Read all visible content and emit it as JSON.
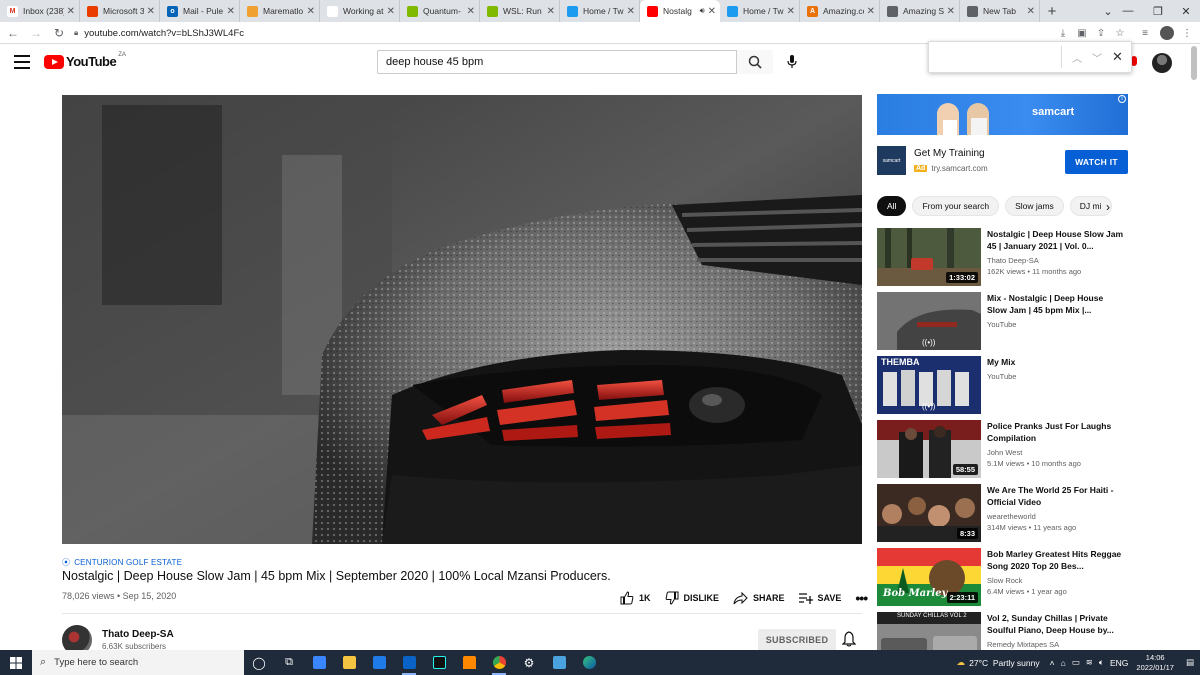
{
  "browser": {
    "tabs": [
      {
        "title": "Inbox (238)",
        "color": "#ffffff",
        "glyph": "M",
        "glyph_color": "#d93025",
        "active": false
      },
      {
        "title": "Microsoft 3",
        "color": "#eb3c00",
        "glyph": "",
        "glyph_color": "#fff",
        "active": false
      },
      {
        "title": "Mail - Pule",
        "color": "#0364b8",
        "glyph": "o",
        "glyph_color": "#fff",
        "active": false
      },
      {
        "title": "Marematlo",
        "color": "#f0a030",
        "glyph": "",
        "glyph_color": "#fff",
        "active": false
      },
      {
        "title": "Working at",
        "color": "#ffffff",
        "glyph": "",
        "glyph_color": "#1a73e8",
        "active": false
      },
      {
        "title": "Quantum-",
        "color": "#7fba00",
        "glyph": "",
        "glyph_color": "#fff",
        "active": false
      },
      {
        "title": "WSL: Run L",
        "color": "#7fba00",
        "glyph": "",
        "glyph_color": "#fff",
        "active": false
      },
      {
        "title": "Home / Tw",
        "color": "#1d9bf0",
        "glyph": "",
        "glyph_color": "#fff",
        "active": false
      },
      {
        "title": "Nostalg",
        "color": "#ff0000",
        "glyph": "",
        "glyph_color": "#fff",
        "active": true
      },
      {
        "title": "Home / Tw",
        "color": "#1d9bf0",
        "glyph": "",
        "glyph_color": "#fff",
        "active": false
      },
      {
        "title": "Amazing.co",
        "color": "#e8710a",
        "glyph": "A",
        "glyph_color": "#fff",
        "active": false
      },
      {
        "title": "Amazing Se",
        "color": "#5f6368",
        "glyph": "",
        "glyph_color": "#fff",
        "active": false
      },
      {
        "title": "New Tab",
        "color": "#5f6368",
        "glyph": "",
        "glyph_color": "#fff",
        "active": false
      }
    ],
    "url": "youtube.com/watch?v=bLShJ3WL4Fc"
  },
  "youtube": {
    "logo_text": "YouTube",
    "country_code": "ZA",
    "search_value": "deep house 45 bpm",
    "search_placeholder": "Search"
  },
  "video": {
    "location": "CENTURION GOLF ESTATE",
    "title": "Nostalgic | Deep House Slow Jam | 45 bpm Mix | September 2020 | 100% Local Mzansi Producers.",
    "meta": "78,026 views • Sep 15, 2020",
    "likes": "1K",
    "dislike_label": "DISLIKE",
    "share_label": "SHARE",
    "save_label": "SAVE",
    "channel_name": "Thato Deep-SA",
    "channel_subs": "6.63K subscribers",
    "subscribed_label": "SUBSCRIBED"
  },
  "ad": {
    "brand": "samcart",
    "title": "Get My Training",
    "badge": "Ad",
    "domain": "try.samcart.com",
    "cta": "WATCH IT",
    "logo_text": "samcart"
  },
  "chips": [
    "All",
    "From your search",
    "Slow jams",
    "DJ mi"
  ],
  "recommendations": [
    {
      "title": "Nostalgic | Deep House Slow Jam 45 | January 2021 | Vol. 0...",
      "channel": "Thato Deep-SA",
      "views": "162K views • 11 months ago",
      "duration": "1:33:02",
      "thumb": "forest"
    },
    {
      "title": "Mix - Nostalgic | Deep House Slow Jam | 45 bpm Mix |...",
      "channel": "YouTube",
      "views": "",
      "duration": "",
      "thumb": "car"
    },
    {
      "title": "My Mix",
      "channel": "YouTube",
      "views": "",
      "duration": "",
      "thumb": "themba",
      "thumb_text": "THEMBA"
    },
    {
      "title": "Police Pranks Just For Laughs Compilation",
      "channel": "John West",
      "views": "5.1M views • 10 months ago",
      "duration": "58:55",
      "thumb": "police"
    },
    {
      "title": "We Are The World 25 For Haiti - Official Video",
      "channel": "wearetheworld",
      "views": "314M views • 11 years ago",
      "duration": "8:33",
      "thumb": "crowd"
    },
    {
      "title": "Bob Marley Greatest Hits Reggae Song 2020 Top 20 Bes...",
      "channel": "Slow Rock",
      "views": "6.4M views • 1 year ago",
      "duration": "2:23:11",
      "thumb": "marley",
      "thumb_text": "Bob Marley"
    },
    {
      "title": "Vol 2, Sunday Chillas | Private Soulful Piano, Deep House by...",
      "channel": "Remedy Mixtapes SA",
      "views": "",
      "duration": "",
      "thumb": "cars",
      "thumb_text": "SUNDAY CHILLAS VOL 2"
    }
  ],
  "taskbar": {
    "search_placeholder": "Type here to search",
    "weather": "27°C  Partly sunny",
    "lang": "ENG",
    "time": "14:06",
    "date": "2022/01/17"
  }
}
